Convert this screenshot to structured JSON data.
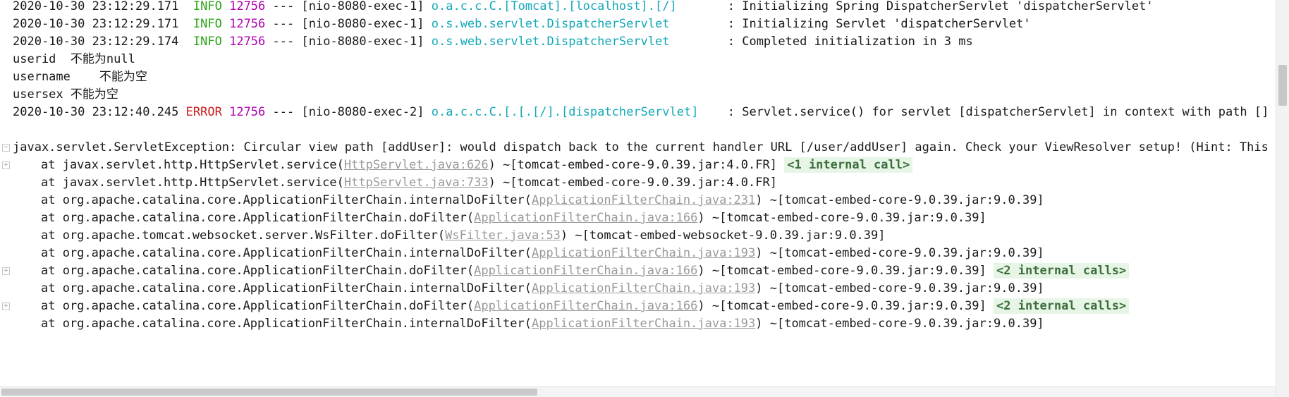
{
  "log": [
    {
      "date": "2020-10-30 23:12:29.171",
      "level": "INFO",
      "pid": "12756",
      "sep": "---",
      "thread": "[nio-8080-exec-1]",
      "logger": "o.a.c.c.C.[Tomcat].[localhost].[/]",
      "message": ": Initializing Spring DispatcherServlet 'dispatcherServlet'"
    },
    {
      "date": "2020-10-30 23:12:29.171",
      "level": "INFO",
      "pid": "12756",
      "sep": "---",
      "thread": "[nio-8080-exec-1]",
      "logger": "o.s.web.servlet.DispatcherServlet",
      "message": ": Initializing Servlet 'dispatcherServlet'"
    },
    {
      "date": "2020-10-30 23:12:29.174",
      "level": "INFO",
      "pid": "12756",
      "sep": "---",
      "thread": "[nio-8080-exec-1]",
      "logger": "o.s.web.servlet.DispatcherServlet",
      "message": ": Completed initialization in 3 ms"
    }
  ],
  "plain": [
    "userid  不能为null",
    "username    不能为空",
    "usersex 不能为空"
  ],
  "error_line": {
    "date": "2020-10-30 23:12:40.245",
    "level": "ERROR",
    "pid": "12756",
    "sep": "---",
    "thread": "[nio-8080-exec-2]",
    "logger": "o.a.c.c.C.[.[.[/].[dispatcherServlet]",
    "message": ": Servlet.service() for servlet [dispatcherServlet] in context with path [] threw"
  },
  "exception": "javax.servlet.ServletException: Circular view path [addUser]: would dispatch back to the current handler URL [/user/addUser] again. Check your ViewResolver setup! (Hint: This may be",
  "stack": [
    {
      "pre": "at javax.servlet.http.HttpServlet.service(",
      "link": "HttpServlet.java:626",
      "post": ") ~[tomcat-embed-core-9.0.39.jar:4.0.FR]",
      "badge": "<1 internal call>"
    },
    {
      "pre": "at javax.servlet.http.HttpServlet.service(",
      "link": "HttpServlet.java:733",
      "post": ") ~[tomcat-embed-core-9.0.39.jar:4.0.FR]",
      "badge": ""
    },
    {
      "pre": "at org.apache.catalina.core.ApplicationFilterChain.internalDoFilter(",
      "link": "ApplicationFilterChain.java:231",
      "post": ") ~[tomcat-embed-core-9.0.39.jar:9.0.39]",
      "badge": ""
    },
    {
      "pre": "at org.apache.catalina.core.ApplicationFilterChain.doFilter(",
      "link": "ApplicationFilterChain.java:166",
      "post": ") ~[tomcat-embed-core-9.0.39.jar:9.0.39]",
      "badge": ""
    },
    {
      "pre": "at org.apache.tomcat.websocket.server.WsFilter.doFilter(",
      "link": "WsFilter.java:53",
      "post": ") ~[tomcat-embed-websocket-9.0.39.jar:9.0.39]",
      "badge": ""
    },
    {
      "pre": "at org.apache.catalina.core.ApplicationFilterChain.internalDoFilter(",
      "link": "ApplicationFilterChain.java:193",
      "post": ") ~[tomcat-embed-core-9.0.39.jar:9.0.39]",
      "badge": ""
    },
    {
      "pre": "at org.apache.catalina.core.ApplicationFilterChain.doFilter(",
      "link": "ApplicationFilterChain.java:166",
      "post": ") ~[tomcat-embed-core-9.0.39.jar:9.0.39]",
      "badge": "<2 internal calls>"
    },
    {
      "pre": "at org.apache.catalina.core.ApplicationFilterChain.internalDoFilter(",
      "link": "ApplicationFilterChain.java:193",
      "post": ") ~[tomcat-embed-core-9.0.39.jar:9.0.39]",
      "badge": ""
    },
    {
      "pre": "at org.apache.catalina.core.ApplicationFilterChain.doFilter(",
      "link": "ApplicationFilterChain.java:166",
      "post": ") ~[tomcat-embed-core-9.0.39.jar:9.0.39]",
      "badge": "<2 internal calls>"
    },
    {
      "pre": "at org.apache.catalina.core.ApplicationFilterChain.internalDoFilter(",
      "link": "ApplicationFilterChain.java:193",
      "post": ") ~[tomcat-embed-core-9.0.39.jar:9.0.39]",
      "badge": ""
    }
  ],
  "icons": {
    "fold": "fold-icon"
  },
  "colors": {
    "info": "#2aa515",
    "error": "#cc1a1a",
    "pid": "#b000b0",
    "logger": "#13a8b8",
    "link": "#9a9a9a",
    "badge_bg": "#e6f5e6"
  }
}
